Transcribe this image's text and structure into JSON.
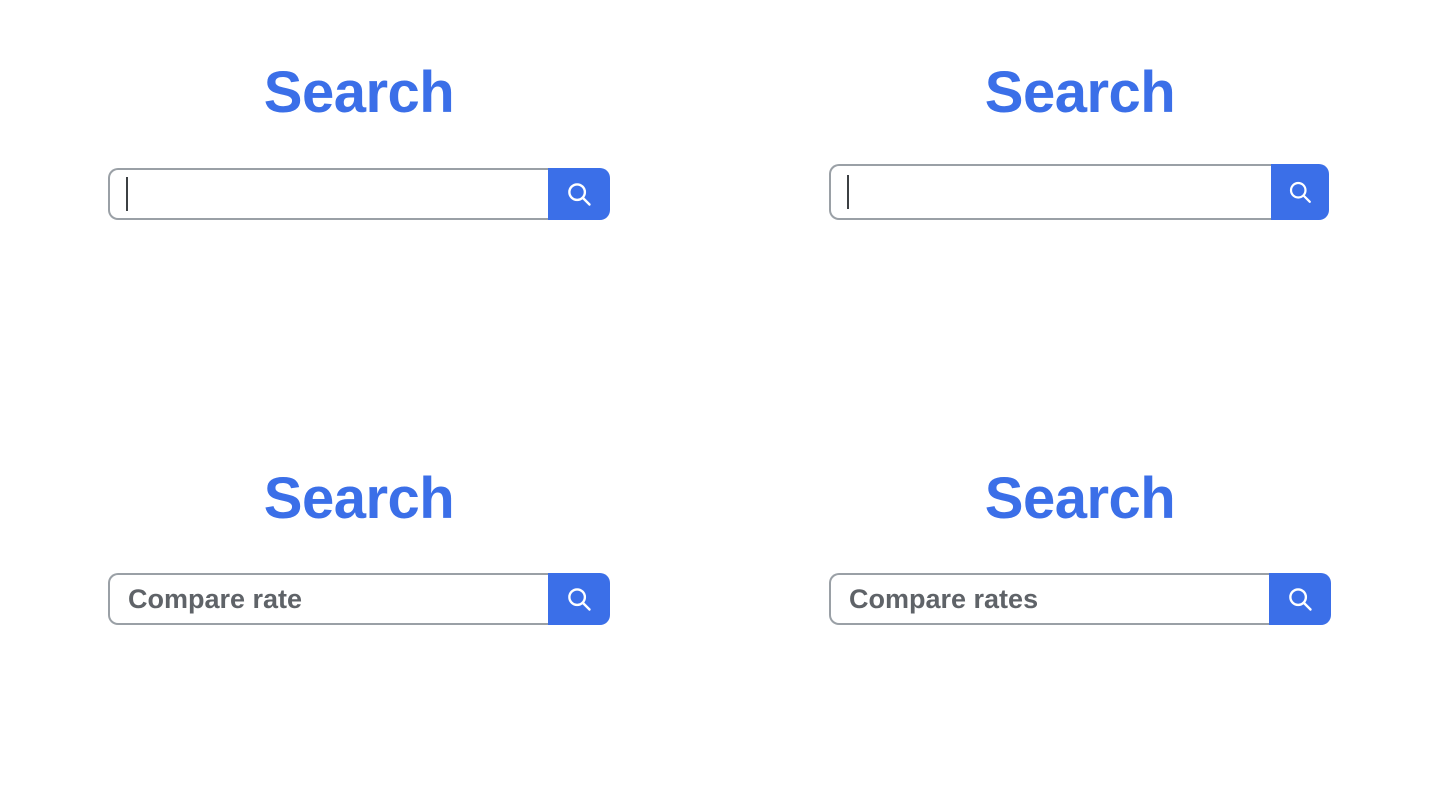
{
  "page": {
    "background_color": "#ffffff",
    "accent_color": "#3b6fe8",
    "border_color": "#9aa0a6",
    "text_color": "#5f6368"
  },
  "widgets": [
    {
      "id": "top-left",
      "title": "Search",
      "input_value": "",
      "placeholder": "",
      "caret_visible": true,
      "button_icon": "search-icon",
      "button_label": "Search"
    },
    {
      "id": "top-right",
      "title": "Search",
      "input_value": "",
      "placeholder": "",
      "caret_visible": true,
      "button_icon": "search-icon",
      "button_label": "Search"
    },
    {
      "id": "bottom-left",
      "title": "Search",
      "input_value": "Compare rate",
      "placeholder": "Compare rate",
      "caret_visible": false,
      "button_icon": "search-icon",
      "button_label": "Search"
    },
    {
      "id": "bottom-right",
      "title": "Search",
      "input_value": "Compare rates",
      "placeholder": "Compare rates",
      "caret_visible": false,
      "button_icon": "search-icon",
      "button_label": "Search"
    }
  ]
}
